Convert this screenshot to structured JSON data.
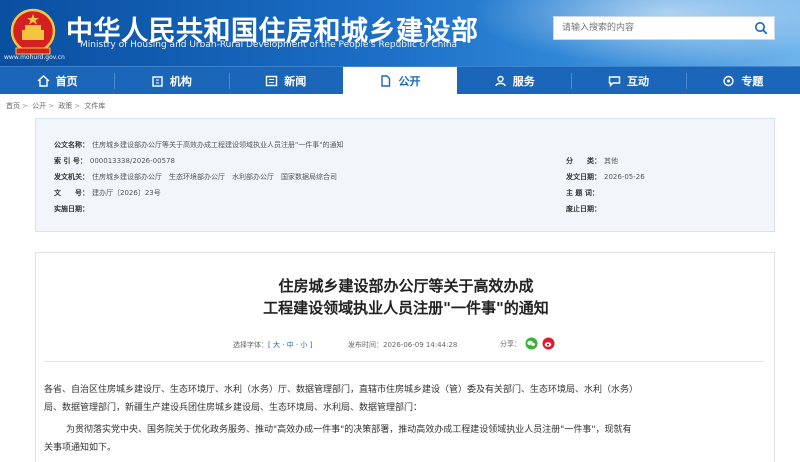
{
  "header": {
    "title": "中华人民共和国住房和城乡建设部",
    "subtitle": "Ministry of Housing and Urban-Rural Development of the People's Republic of China",
    "url": "www.mohurd.gov.cn",
    "search_placeholder": "请输入搜索的内容",
    "colors": {
      "primary": "#1b66b8",
      "header_dark": "#0a4fa0"
    }
  },
  "nav": {
    "items": [
      {
        "label": "首页",
        "icon": "home-icon"
      },
      {
        "label": "机构",
        "icon": "building-icon"
      },
      {
        "label": "新闻",
        "icon": "news-icon"
      },
      {
        "label": "公开",
        "icon": "document-icon",
        "active": true
      },
      {
        "label": "服务",
        "icon": "service-icon"
      },
      {
        "label": "互动",
        "icon": "chat-icon"
      },
      {
        "label": "专题",
        "icon": "topic-icon"
      }
    ]
  },
  "breadcrumb": [
    "首页",
    "公开",
    "政策",
    "文件库"
  ],
  "meta": {
    "name_label": "公文名称：",
    "name_value": "住房城乡建设部办公厅等关于高效办成工程建设领域执业人员注册\"一件事\"的通知",
    "index_label": "索 引 号：",
    "index_value": "000013338/2026-00578",
    "class_label": "分　　类：",
    "class_value": "其他",
    "issuer_label": "发文机关：",
    "issuer_value": "住房城乡建设部办公厅　生态环境部办公厅　水利部办公厅　国家数据局综合司",
    "date_label": "发文日期：",
    "date_value": "2026-05-26",
    "number_label": "文　　号：",
    "number_value": "建办厅〔2026〕23号",
    "topic_label": "主 题 词：",
    "topic_value": "",
    "effective_label": "实施日期：",
    "effective_value": "",
    "expire_label": "废止日期：",
    "expire_value": ""
  },
  "article": {
    "title_line1": "住房城乡建设部办公厅等关于高效办成",
    "title_line2": "工程建设领域执业人员注册\"一件事\"的通知",
    "font_label": "选择字体：",
    "font_open": "[ ",
    "font_large": "大",
    "font_sep1": " · ",
    "font_medium": "中",
    "font_sep2": " · ",
    "font_small": "小",
    "font_close": " ]",
    "publish_label": "发布时间：",
    "publish_time": "2026-06-09 14:44:28",
    "share_label": "分享：",
    "paragraph1_line1": "各省、自治区住房城乡建设厅、生态环境厅、水利（水务）厅、数据管理部门，直辖市住房城乡建设（管）委及有关部门、生态环境局、水利（水务）",
    "paragraph1_line2": "局、数据管理部门，新疆生产建设兵团住房城乡建设局、生态环境局、水利局、数据管理部门：",
    "paragraph2_line1": "为贯彻落实党中央、国务院关于优化政务服务、推动\"高效办成一件事\"的决策部署，推动高效办成工程建设领域执业人员注册\"一件事\"，现就有",
    "paragraph2_line2": "关事项通知如下。"
  }
}
